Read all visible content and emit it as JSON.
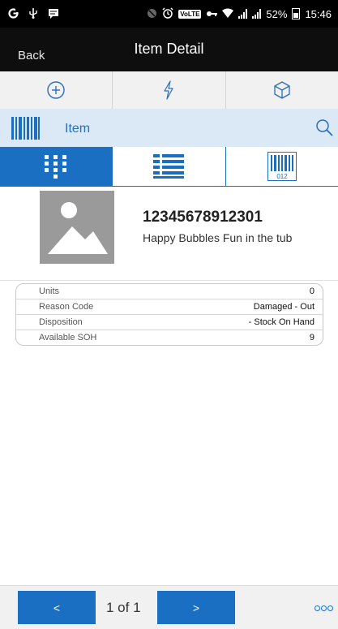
{
  "status_bar": {
    "battery_percent": "52%",
    "time": "15:46",
    "network_badge": "VoLTE",
    "icons": [
      "google-icon",
      "usb-icon",
      "message-icon",
      "mute-icon",
      "alarm-icon",
      "volte-icon",
      "key-icon",
      "wifi-icon",
      "signal-icon",
      "signal-icon",
      "battery-icon"
    ]
  },
  "header": {
    "back_label": "Back",
    "title": "Item Detail"
  },
  "action_bar": {
    "items": [
      {
        "icon": "add-circle-icon"
      },
      {
        "icon": "lightning-icon"
      },
      {
        "icon": "box-icon"
      }
    ]
  },
  "search": {
    "label": "Item",
    "icons": [
      "barcode-scan-icon",
      "search-icon"
    ]
  },
  "tabs": [
    {
      "icon": "keypad-icon",
      "active": true
    },
    {
      "icon": "list-icon",
      "active": false
    },
    {
      "icon": "barcode-icon",
      "active": false,
      "caption": "012"
    }
  ],
  "item": {
    "sku": "12345678912301",
    "description": "Happy Bubbles Fun in the tub",
    "image_icon": "image-placeholder-icon"
  },
  "details": [
    {
      "key": "Units",
      "value": "0"
    },
    {
      "key": "Reason Code",
      "value": "Damaged - Out"
    },
    {
      "key": "Disposition",
      "value": "- Stock On Hand"
    },
    {
      "key": "Available SOH",
      "value": "9"
    }
  ],
  "pager": {
    "prev_label": "<",
    "next_label": ">",
    "page_info": "1 of 1",
    "more_icon": "more-dots-icon"
  },
  "colors": {
    "accent": "#1a6fc2",
    "search_bg": "#dbe9f6",
    "header_bg": "#0e0e0e"
  }
}
